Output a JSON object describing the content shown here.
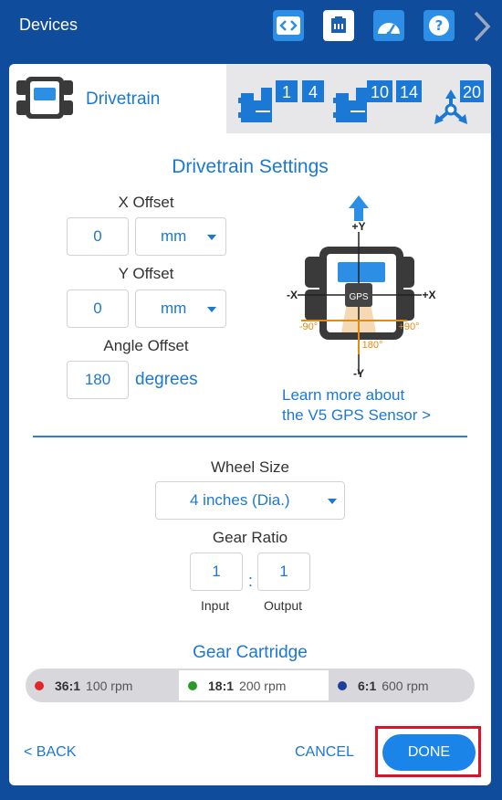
{
  "topbar": {
    "title": "Devices",
    "buttons": [
      {
        "name": "code-icon",
        "active": false
      },
      {
        "name": "ports-icon",
        "active": true
      },
      {
        "name": "dashboard-icon",
        "active": false
      },
      {
        "name": "help-icon",
        "active": false
      }
    ]
  },
  "device": {
    "label": "Drivetrain",
    "ports": {
      "left_motor": [
        "1",
        "4"
      ],
      "right_motor": [
        "10",
        "14"
      ],
      "gps": "20"
    }
  },
  "settings": {
    "title": "Drivetrain Settings",
    "x_offset": {
      "label": "X Offset",
      "value": "0",
      "unit": "mm"
    },
    "y_offset": {
      "label": "Y Offset",
      "value": "0",
      "unit": "mm"
    },
    "angle_offset": {
      "label": "Angle Offset",
      "value": "180",
      "unit": "degrees"
    },
    "diagram": {
      "plus_y": "+Y",
      "minus_y": "-Y",
      "plus_x": "+X",
      "minus_x": "-X",
      "gps": "GPS",
      "neg90": "-90°",
      "pos90": "+90°",
      "deg180": "180°"
    },
    "learn_more": [
      "Learn more about",
      "the V5 GPS Sensor >"
    ]
  },
  "wheel": {
    "label": "Wheel Size",
    "value": "4 inches (Dia.)"
  },
  "gear_ratio": {
    "label": "Gear Ratio",
    "input": "1",
    "output": "1",
    "separator": ":",
    "input_label": "Input",
    "output_label": "Output"
  },
  "cartridge": {
    "title": "Gear Cartridge",
    "options": [
      {
        "ratio": "36:1",
        "rpm": "100 rpm",
        "color": "#e0262b",
        "selected": false
      },
      {
        "ratio": "18:1",
        "rpm": "200 rpm",
        "color": "#2a9a2a",
        "selected": true
      },
      {
        "ratio": "6:1",
        "rpm": "600 rpm",
        "color": "#1b3f9c",
        "selected": false
      }
    ]
  },
  "footer": {
    "back": "< BACK",
    "cancel": "CANCEL",
    "done": "DONE"
  },
  "colors": {
    "accent": "#1b78d4",
    "topbar": "#0f4c9c",
    "done": "#1b84e8",
    "highlight": "#e0102b",
    "orange": "#e8890f"
  }
}
